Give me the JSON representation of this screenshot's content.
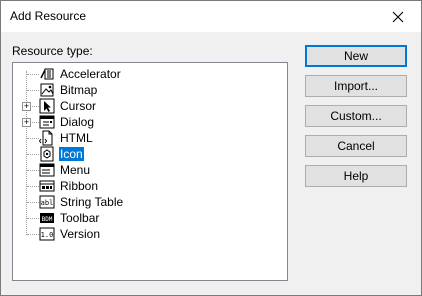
{
  "window": {
    "title": "Add Resource"
  },
  "tree": {
    "label": "Resource type:",
    "items": [
      {
        "label": "Accelerator",
        "icon": "accelerator-icon",
        "expandable": false,
        "selected": false
      },
      {
        "label": "Bitmap",
        "icon": "bitmap-icon",
        "expandable": false,
        "selected": false
      },
      {
        "label": "Cursor",
        "icon": "cursor-icon",
        "expandable": true,
        "selected": false
      },
      {
        "label": "Dialog",
        "icon": "dialog-icon",
        "expandable": true,
        "selected": false
      },
      {
        "label": "HTML",
        "icon": "html-icon",
        "expandable": false,
        "selected": false
      },
      {
        "label": "Icon",
        "icon": "icon-resource-icon",
        "expandable": false,
        "selected": true
      },
      {
        "label": "Menu",
        "icon": "menu-icon",
        "expandable": false,
        "selected": false
      },
      {
        "label": "Ribbon",
        "icon": "ribbon-icon",
        "expandable": false,
        "selected": false
      },
      {
        "label": "String Table",
        "icon": "string-table-icon",
        "expandable": false,
        "selected": false
      },
      {
        "label": "Toolbar",
        "icon": "toolbar-icon",
        "expandable": false,
        "selected": false
      },
      {
        "label": "Version",
        "icon": "version-icon",
        "expandable": false,
        "selected": false
      }
    ],
    "expander_symbol": "+",
    "icon_texts": {
      "string_table": "abl",
      "toolbar": "BDM",
      "version": "1.0"
    }
  },
  "buttons": {
    "new": "New",
    "import": "Import...",
    "custom": "Custom...",
    "cancel": "Cancel",
    "help": "Help"
  },
  "colors": {
    "selection": "#0078d7",
    "default_button_border": "#0078d7"
  }
}
